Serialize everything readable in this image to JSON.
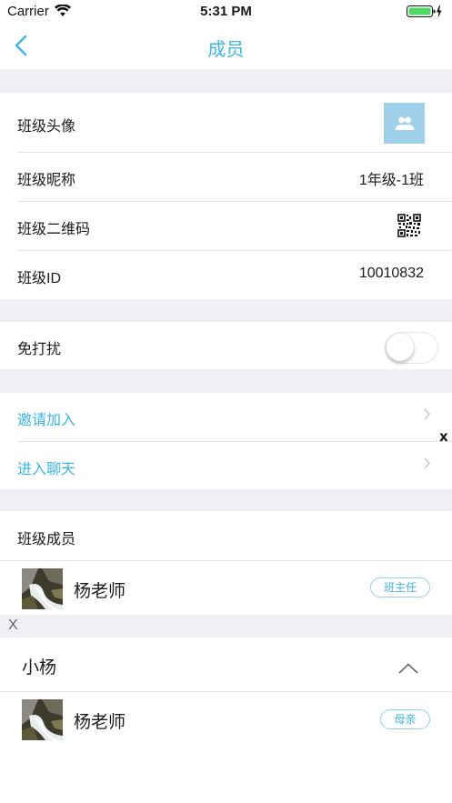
{
  "status_bar": {
    "carrier": "Carrier",
    "time": "5:31 PM",
    "battery_color": "#4cd964"
  },
  "nav": {
    "title": "成员",
    "accent": "#39b6e8"
  },
  "class_info": {
    "avatar_label": "班级头像",
    "nickname_label": "班级昵称",
    "nickname_value": "1年级-1班",
    "qrcode_label": "班级二维码",
    "id_label": "班级ID",
    "id_value": "10010832"
  },
  "settings": {
    "dnd_label": "免打扰",
    "dnd_enabled": false
  },
  "actions": {
    "invite_label": "邀请加入",
    "chat_label": "进入聊天"
  },
  "members": {
    "header": "班级成员",
    "teacher": {
      "name": "杨老师",
      "role": "班主任"
    }
  },
  "overlay_close_right": "x",
  "overlay_close_left": "X",
  "group": {
    "title": "小杨",
    "member": {
      "name": "杨老师",
      "role": "母亲"
    }
  }
}
